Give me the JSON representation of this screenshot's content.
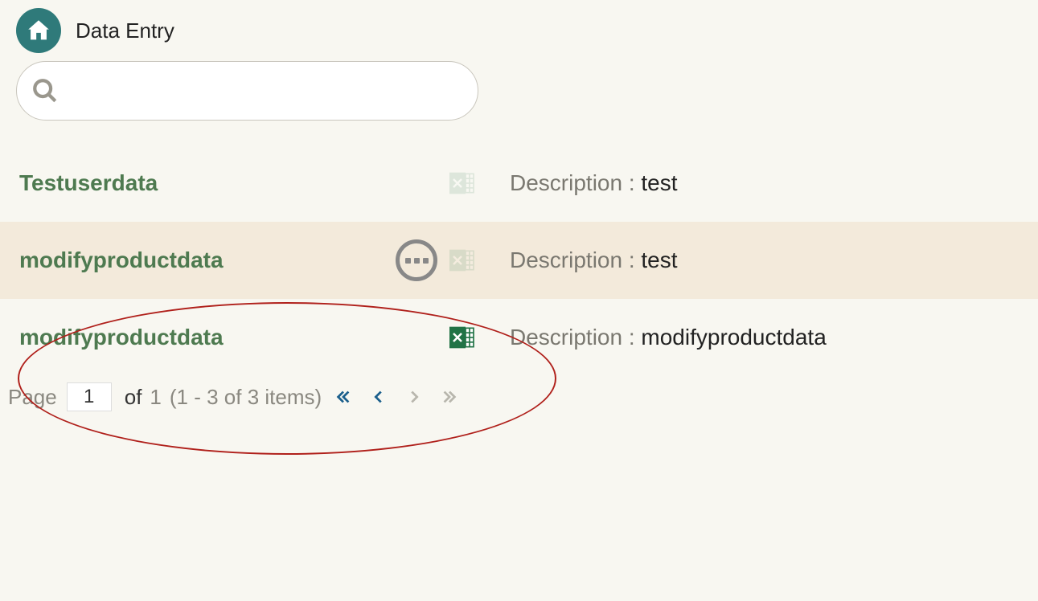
{
  "header": {
    "title": "Data Entry"
  },
  "search": {
    "value": "",
    "placeholder": ""
  },
  "rows": [
    {
      "name": "Testuserdata",
      "desc_label": "Description : ",
      "desc_value": "test",
      "has_menu": false,
      "excel_faded": true,
      "highlight": false
    },
    {
      "name": "modifyproductdata",
      "desc_label": "Description : ",
      "desc_value": "test",
      "has_menu": true,
      "excel_faded": true,
      "highlight": true
    },
    {
      "name": "modifyproductdata",
      "desc_label": "Description : ",
      "desc_value": "modifyproductdata",
      "has_menu": false,
      "excel_faded": false,
      "highlight": false
    }
  ],
  "pager": {
    "prefix": "Page",
    "current": "1",
    "of_label": "of",
    "total_pages": "1",
    "range_text": "(1 - 3 of 3 items)"
  }
}
